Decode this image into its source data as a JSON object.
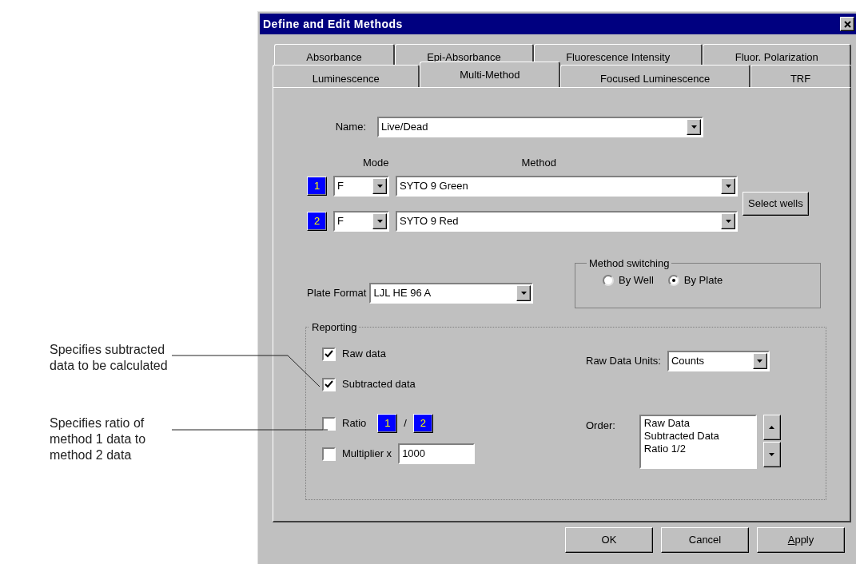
{
  "annotations": [
    {
      "lines": [
        "Specifies subtracted",
        "data to be calculated"
      ]
    },
    {
      "lines": [
        "Specifies ratio of",
        "method 1 data to",
        "method 2 data"
      ]
    }
  ],
  "window": {
    "title": "Define and Edit Methods"
  },
  "tab_rows": [
    [
      {
        "label": "Absorbance",
        "selected": false
      },
      {
        "label": "Epi-Absorbance",
        "selected": false
      },
      {
        "label": "Fluorescence Intensity",
        "selected": false
      },
      {
        "label": "Fluor. Polarization",
        "selected": false
      }
    ],
    [
      {
        "label": "Luminescence",
        "selected": false
      },
      {
        "label": "Multi-Method",
        "selected": true
      },
      {
        "label": "Focused Luminescence",
        "selected": false
      },
      {
        "label": "TRF",
        "selected": false
      }
    ]
  ],
  "name": {
    "label": "Name:",
    "value": "Live/Dead"
  },
  "method_headers": {
    "mode": "Mode",
    "method": "Method"
  },
  "methods": [
    {
      "index": "1",
      "mode": "F",
      "method": "SYTO 9 Green"
    },
    {
      "index": "2",
      "mode": "F",
      "method": "SYTO 9 Red"
    }
  ],
  "select_wells": "Select wells",
  "plate_format": {
    "label": "Plate Format",
    "value": "LJL HE 96 A"
  },
  "method_switching": {
    "title": "Method switching",
    "options": [
      {
        "label": "By Well",
        "selected": false
      },
      {
        "label": "By Plate",
        "selected": true
      }
    ]
  },
  "reporting": {
    "title": "Reporting",
    "checks": [
      {
        "label": "Raw data",
        "checked": true
      },
      {
        "label": "Subtracted data",
        "checked": true
      }
    ],
    "ratio": {
      "label": "Ratio",
      "checked": false,
      "numerator": "1",
      "separator": "/",
      "denominator": "2"
    },
    "multiplier": {
      "label": "Multiplier x",
      "checked": false,
      "value": "1000"
    },
    "raw_data_units": {
      "label": "Raw Data Units:",
      "value": "Counts"
    },
    "order": {
      "label": "Order:",
      "items": [
        "Raw Data",
        "Subtracted Data",
        "Ratio 1/2"
      ]
    }
  },
  "buttons": [
    {
      "label": "OK",
      "underline_first": false
    },
    {
      "label": "Cancel",
      "underline_first": false
    },
    {
      "label": "Apply",
      "underline_first": true
    }
  ]
}
